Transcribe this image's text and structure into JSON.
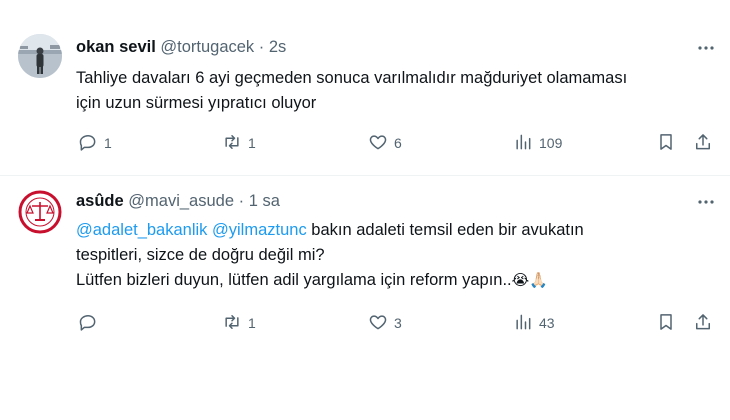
{
  "tweets": [
    {
      "name": "okan sevil",
      "handle": "@tortugacek",
      "dot": "·",
      "time": "2s",
      "text_line1": "Tahliye davaları 6 ayi geçmeden sonuca varılmalıdır mağduriyet olamaması",
      "text_line2": "için uzun sürmesi yıpratıcı oluyor",
      "replies": "1",
      "retweets": "1",
      "likes": "6",
      "views": "109"
    },
    {
      "name": "asûde",
      "handle": "@mavi_asude",
      "dot": "·",
      "time": "1 sa",
      "mention1": "@adalet_bakanlik",
      "mention2": "@yilmaztunc",
      "text_line1_rest": " bakın adaleti temsil eden bir avukatın",
      "text_line2": "tespitleri, sizce de doğru değil mi?",
      "text_line3": "Lütfen bizleri duyun, lütfen adil yargılama için reform yapın..",
      "emojis": "😭🙏🏻",
      "replies": "",
      "retweets": "1",
      "likes": "3",
      "views": "43"
    }
  ],
  "icons": {
    "reply": "reply-icon",
    "retweet": "retweet-icon",
    "like": "heart-icon",
    "views": "views-icon",
    "bookmark": "bookmark-icon",
    "share": "share-icon",
    "more": "more-icon"
  },
  "colors": {
    "mention": "#1d9bf0",
    "secondary": "#536471",
    "text": "#0f1419"
  }
}
